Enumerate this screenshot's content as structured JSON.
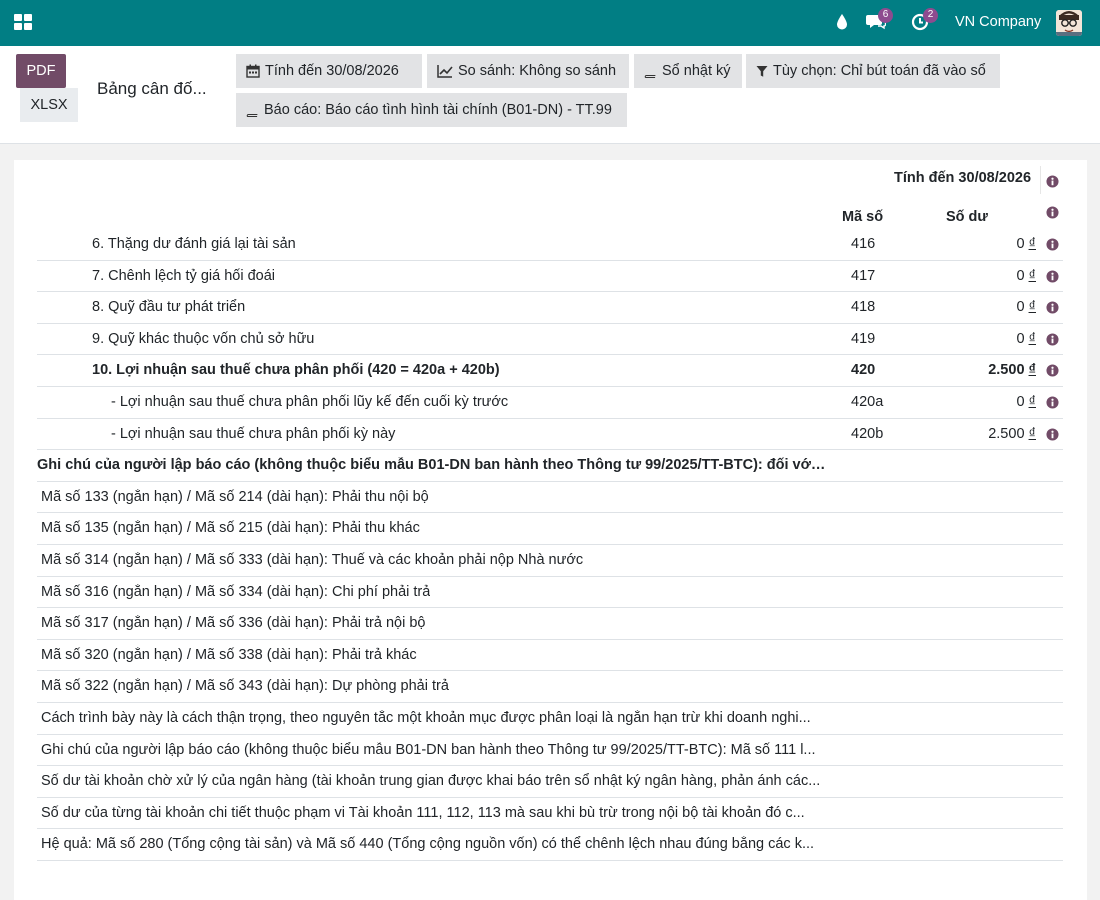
{
  "navbar": {
    "company": "VN Company",
    "chat_badge": "6",
    "activity_badge": "2",
    "colors": {
      "bar": "#017e84",
      "badge": "#8e4b8f"
    }
  },
  "control_panel": {
    "pdf_label": "PDF",
    "xlsx_label": "XLSX",
    "report_title": "Bảng cân đố...",
    "filters": {
      "date": "Tính đến 30/08/2026",
      "compare": "So sánh: Không so sánh",
      "journals": "Sổ nhật ký",
      "options": "Tùy chọn: Chỉ bút toán đã vào sổ",
      "report": "Báo cáo: Báo cáo tình hình tài chính (B01-DN) - TT.99"
    }
  },
  "table": {
    "header_date": "Tính đến 30/08/2026",
    "col_code": "Mã số",
    "col_balance": "Số dư",
    "currency": "₫",
    "rows": [
      {
        "name": "6. Thặng dư đánh giá lại tài sản",
        "code": "416",
        "balance": "0"
      },
      {
        "name": "7. Chênh lệch tỷ giá hối đoái",
        "code": "417",
        "balance": "0"
      },
      {
        "name": "8. Quỹ đầu tư phát triển",
        "code": "418",
        "balance": "0"
      },
      {
        "name": "9. Quỹ khác thuộc vốn chủ sở hữu",
        "code": "419",
        "balance": "0"
      },
      {
        "name": "10. Lợi nhuận sau thuế chưa phân phối (420 = 420a + 420b)",
        "code": "420",
        "balance": "2.500"
      },
      {
        "name": "- Lợi nhuận sau thuế chưa phân phối lũy kế đến cuối kỳ trước",
        "code": "420a",
        "balance": "0"
      },
      {
        "name": "- Lợi nhuận sau thuế chưa phân phối kỳ này",
        "code": "420b",
        "balance": "2.500"
      }
    ]
  },
  "notes": {
    "heading": "Ghi chú của người lập báo cáo (không thuộc biểu mẫu B01-DN ban hành theo Thông tư 99/2025/TT-BTC): đối với các ...",
    "items": [
      "Mã số 133 (ngắn hạn) / Mã số 214 (dài hạn): Phải thu nội bộ",
      "Mã số 135 (ngắn hạn) / Mã số 215 (dài hạn): Phải thu khác",
      "Mã số 314 (ngắn hạn) / Mã số 333 (dài hạn): Thuế và các khoản phải nộp Nhà nước",
      "Mã số 316 (ngắn hạn) / Mã số 334 (dài hạn): Chi phí phải trả",
      "Mã số 317 (ngắn hạn) / Mã số 336 (dài hạn): Phải trả nội bộ",
      "Mã số 320 (ngắn hạn) / Mã số 338 (dài hạn): Phải trả khác",
      "Mã số 322 (ngắn hạn) / Mã số 343 (dài hạn): Dự phòng phải trả",
      "Cách trình bày này là cách thận trọng, theo nguyên tắc một khoản mục được phân loại là ngắn hạn trừ khi doanh nghi...",
      "Ghi chú của người lập báo cáo (không thuộc biểu mẫu B01-DN ban hành theo Thông tư 99/2025/TT-BTC): Mã số 111 l...",
      "Số dư tài khoản chờ xử lý của ngân hàng (tài khoản trung gian được khai báo trên sổ nhật ký ngân hàng, phản ánh các...",
      "Số dư của từng tài khoản chi tiết thuộc phạm vi Tài khoản 111, 112, 113 mà sau khi bù trừ trong nội bộ tài khoản đó c...",
      "Hệ quả: Mã số 280 (Tổng cộng tài sản) và Mã số 440 (Tổng cộng nguồn vốn) có thể chênh lệch nhau đúng bằng các k..."
    ]
  }
}
